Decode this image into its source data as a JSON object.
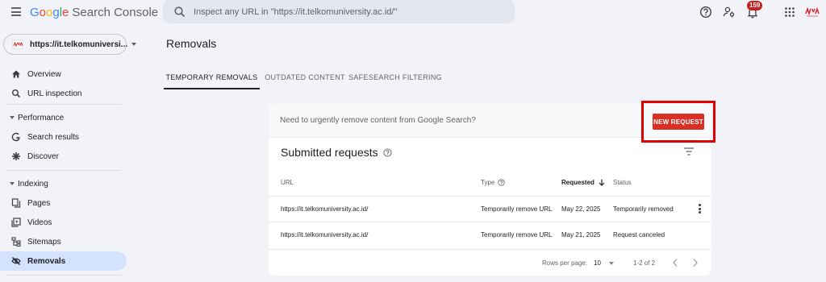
{
  "app": {
    "logo_google": [
      "G",
      "o",
      "o",
      "g",
      "l",
      "e"
    ],
    "logo_colors": [
      "#4285f4",
      "#ea4335",
      "#fbbc05",
      "#4285f4",
      "#34a853",
      "#ea4335"
    ],
    "logo_product": "Search Console",
    "search_placeholder": "Inspect any URL in \"https://it.telkomuniversity.ac.id/\"",
    "notifications_count": "159",
    "header_icons": [
      "hamburger-menu-icon",
      "search-icon",
      "help-icon",
      "manage-users-icon",
      "notifications-bell-icon",
      "apps-grid-icon",
      "account-avatar"
    ]
  },
  "sidebar": {
    "property": "https://it.telkomuniversi...",
    "items": [
      {
        "label": "Overview",
        "icon": "home-icon"
      },
      {
        "label": "URL inspection",
        "icon": "search-icon"
      },
      {
        "label": "Performance",
        "icon": "expand-triangle-icon"
      },
      {
        "label": "Search results",
        "icon": "google-g-icon"
      },
      {
        "label": "Discover",
        "icon": "asterisk-icon"
      },
      {
        "label": "Indexing",
        "icon": "expand-triangle-icon"
      },
      {
        "label": "Pages",
        "icon": "pages-icon"
      },
      {
        "label": "Videos",
        "icon": "video-icon"
      },
      {
        "label": "Sitemaps",
        "icon": "sitemap-icon"
      },
      {
        "label": "Removals",
        "icon": "eye-off-icon"
      }
    ]
  },
  "main": {
    "title": "Removals",
    "tabs": [
      {
        "label": "TEMPORARY REMOVALS"
      },
      {
        "label": "OUTDATED CONTENT"
      },
      {
        "label": "SAFESEARCH FILTERING"
      }
    ],
    "card": {
      "question": "Need to urgently remove content from Google Search?",
      "new_request_label": "NEW REQUEST",
      "submitted_title": "Submitted requests",
      "columns": [
        "URL",
        "Type",
        "Requested",
        "Status"
      ],
      "rows": [
        {
          "url": "https://it.telkomuniversity.ac.id/",
          "type": "Temporarily remove URL",
          "requested": "May 22, 2025",
          "status": "Temporarily removed"
        },
        {
          "url": "https://it.telkomuniversity.ac.id/",
          "type": "Temporarily remove URL",
          "requested": "May 21, 2025",
          "status": "Request canceled"
        }
      ],
      "footer": {
        "rows_per_page_label": "Rows per page:",
        "rows_per_page_value": "10",
        "range": "1-2 of 2"
      }
    },
    "accent_colors": {
      "new_request": "#d93025",
      "highlight_box": "#e00000",
      "active_nav": "#d3e3fd"
    }
  }
}
